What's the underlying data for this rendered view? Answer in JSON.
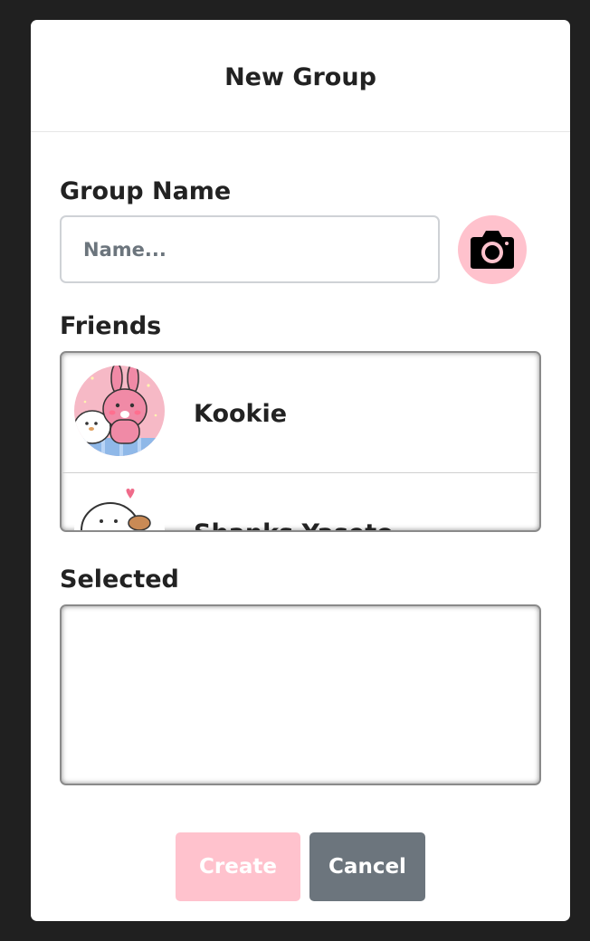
{
  "dialog": {
    "title": "New Group"
  },
  "group_name": {
    "label": "Group Name",
    "placeholder": "Name...",
    "value": "",
    "camera_icon": "camera-icon"
  },
  "friends": {
    "label": "Friends",
    "items": [
      {
        "name": "Kookie",
        "avatar": "pink-rabbit-avatar"
      },
      {
        "name": "Shanks Yaseto",
        "avatar": "white-seal-avatar"
      }
    ]
  },
  "selected": {
    "label": "Selected",
    "items": []
  },
  "actions": {
    "create_label": "Create",
    "cancel_label": "Cancel"
  },
  "colors": {
    "accent_pink": "#ffc2cd",
    "secondary_gray": "#6c757d",
    "backdrop": "#202020"
  }
}
